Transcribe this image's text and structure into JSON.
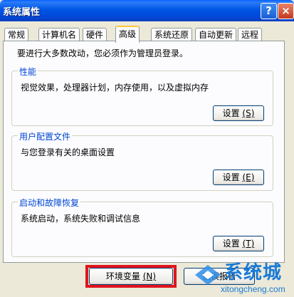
{
  "window": {
    "title": "系统属性",
    "help_label": "?",
    "close_label": "×"
  },
  "tabs": [
    {
      "label": "常规"
    },
    {
      "label": "计算机名"
    },
    {
      "label": "硬件"
    },
    {
      "label": "高级",
      "active": true
    },
    {
      "label": "系统还原"
    },
    {
      "label": "自动更新"
    },
    {
      "label": "远程"
    }
  ],
  "admin_note": "要进行大多数改动，您必须作为管理员登录。",
  "groups": {
    "performance": {
      "title": "性能",
      "description": "视觉效果，处理器计划，内存使用，以及虚拟内存",
      "button_text": "设置",
      "button_key": "(S)"
    },
    "user_profiles": {
      "title": "用户配置文件",
      "description": "与您登录有关的桌面设置",
      "button_text": "设置",
      "button_key": "(E)"
    },
    "startup_recovery": {
      "title": "启动和故障恢复",
      "description": "系统启动，系统失败和调试信息",
      "button_text": "设置",
      "button_key": "(T)"
    }
  },
  "bottom_buttons": {
    "env_vars": {
      "text": "环境变量",
      "key": "(N)"
    },
    "error_report": {
      "text": "错误报告"
    }
  },
  "watermark": {
    "name": "系统城",
    "domain": "xitongcheng.com"
  },
  "colors": {
    "title_bar": "#0055e5",
    "highlight": "#e0141e",
    "group_title": "#0046d5"
  }
}
